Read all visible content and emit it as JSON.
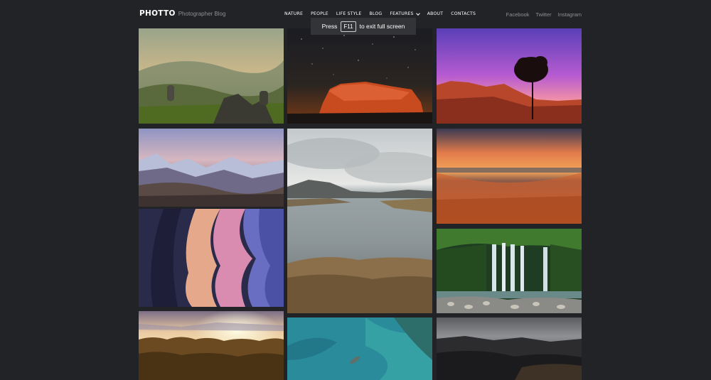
{
  "logo": {
    "brand": "PHOTTO",
    "tagline": "Photographer Blog"
  },
  "nav": {
    "nature": "NATURE",
    "people": "PEOPLE",
    "lifestyle": "LIFE STYLE",
    "blog": "BLOG",
    "features": "FEATURES",
    "about": "ABOUT",
    "contacts": "CONTACTS"
  },
  "social": {
    "facebook": "Facebook",
    "twitter": "Twitter",
    "instagram": "Instagram"
  },
  "toast": {
    "press": "Press",
    "key": "F11",
    "rest": "to exit full screen"
  },
  "colors": {
    "background": "#222326",
    "muted_text": "#8e8f93",
    "toast_bg": "#333437"
  },
  "gallery": [
    {
      "id": "mountain-valley-photo"
    },
    {
      "id": "starry-rock-photo"
    },
    {
      "id": "purple-sunset-tree-photo"
    },
    {
      "id": "snowy-mountains-photo"
    },
    {
      "id": "cloudy-lake-photo"
    },
    {
      "id": "orange-beach-sunset-photo"
    },
    {
      "id": "canyon-photo"
    },
    {
      "id": "waterfall-photo"
    },
    {
      "id": "forest-sunrise-photo"
    },
    {
      "id": "turquoise-sea-boat-photo"
    },
    {
      "id": "dark-mountain-photo"
    }
  ]
}
